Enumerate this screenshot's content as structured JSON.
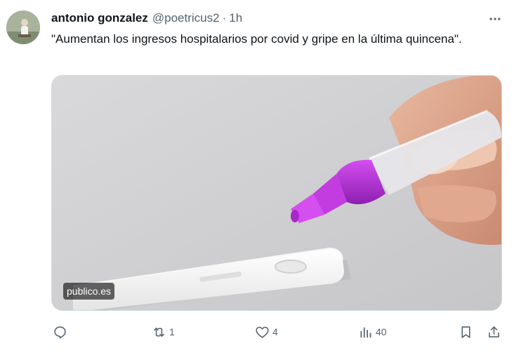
{
  "tweet": {
    "author_name": "antonio gonzalez",
    "handle": "@poetricus2",
    "separator": "·",
    "time": "1h",
    "text": "\"Aumentan los ingresos hospitalarios por covid y gripe en la última quincena\".",
    "media": {
      "source_label": "publico.es"
    }
  },
  "actions": {
    "reply_count": "",
    "retweet_count": "1",
    "like_count": "4",
    "views_count": "40"
  },
  "colors": {
    "text_primary": "#0f1419",
    "text_secondary": "#536471",
    "border": "#cfd9de",
    "cap_purple": "#b02fd0"
  },
  "icons": [
    "more-icon",
    "reply-icon",
    "retweet-icon",
    "like-icon",
    "views-icon",
    "bookmark-icon",
    "share-icon"
  ]
}
